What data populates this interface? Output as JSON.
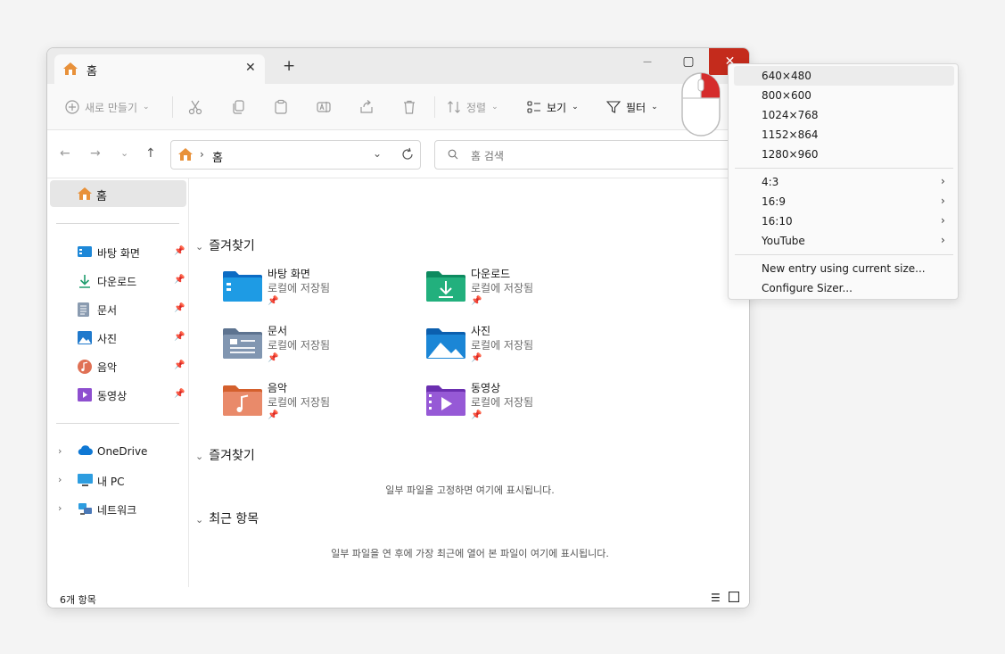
{
  "tab": {
    "title": "홈",
    "close": "✕",
    "new": "+"
  },
  "window_controls": {
    "minimize": "—",
    "maximize": "▢",
    "close": "✕"
  },
  "toolbar": {
    "new_label": "새로 만들기",
    "sort_label": "정렬",
    "view_label": "보기",
    "filter_label": "필터"
  },
  "address": {
    "path": "홈",
    "separator": "›"
  },
  "search": {
    "placeholder": "홈 검색"
  },
  "sidebar": {
    "home": "홈",
    "pinned": [
      {
        "label": "바탕 화면"
      },
      {
        "label": "다운로드"
      },
      {
        "label": "문서"
      },
      {
        "label": "사진"
      },
      {
        "label": "음악"
      },
      {
        "label": "동영상"
      }
    ],
    "locations": [
      {
        "label": "OneDrive"
      },
      {
        "label": "내 PC"
      },
      {
        "label": "네트워크"
      }
    ]
  },
  "content": {
    "section1": "즐겨찾기",
    "folders": [
      {
        "name": "바탕 화면",
        "sub": "로컬에 저장됨"
      },
      {
        "name": "다운로드",
        "sub": "로컬에 저장됨"
      },
      {
        "name": "문서",
        "sub": "로컬에 저장됨"
      },
      {
        "name": "사진",
        "sub": "로컬에 저장됨"
      },
      {
        "name": "음악",
        "sub": "로컬에 저장됨"
      },
      {
        "name": "동영상",
        "sub": "로컬에 저장됨"
      }
    ],
    "section2": "즐겨찾기",
    "section2_empty": "일부 파일을 고정하면 여기에 표시됩니다.",
    "section3": "최근 항목",
    "section3_empty": "일부 파일을 연 후에 가장 최근에 열어 본 파일이 여기에 표시됩니다."
  },
  "status": {
    "count": "6개 항목"
  },
  "menu": {
    "sizes": [
      "640×480",
      "800×600",
      "1024×768",
      "1152×864",
      "1280×960"
    ],
    "ratios": [
      "4:3",
      "16:9",
      "16:10",
      "YouTube"
    ],
    "actions": [
      "New entry using current size...",
      "Configure Sizer..."
    ]
  },
  "colors": {
    "close_red": "#c42b1c",
    "accent": "#0067c0"
  }
}
